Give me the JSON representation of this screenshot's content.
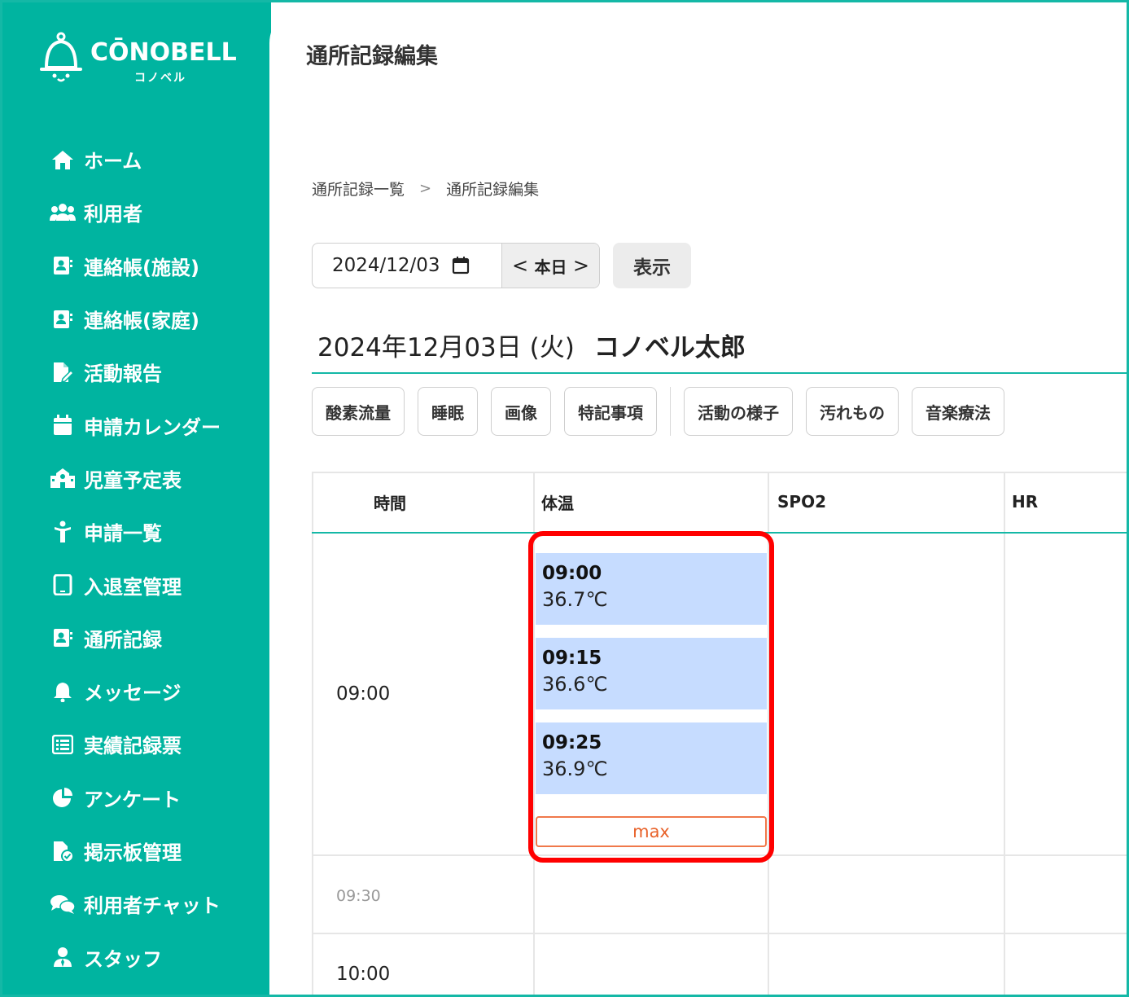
{
  "brand": {
    "name": "CŌNOBELL",
    "sub": "コノベル"
  },
  "sidebar": {
    "items": [
      {
        "label": "ホーム",
        "icon": "home-icon"
      },
      {
        "label": "利用者",
        "icon": "users-icon"
      },
      {
        "label": "連絡帳(施設)",
        "icon": "contact-book-icon"
      },
      {
        "label": "連絡帳(家庭)",
        "icon": "contact-book-icon"
      },
      {
        "label": "活動報告",
        "icon": "report-edit-icon"
      },
      {
        "label": "申請カレンダー",
        "icon": "calendar-icon"
      },
      {
        "label": "児童予定表",
        "icon": "school-icon"
      },
      {
        "label": "申請一覧",
        "icon": "child-icon"
      },
      {
        "label": "入退室管理",
        "icon": "tablet-icon"
      },
      {
        "label": "通所記録",
        "icon": "contact-book-icon"
      },
      {
        "label": "メッセージ",
        "icon": "bell-icon"
      },
      {
        "label": "実績記録票",
        "icon": "list-table-icon"
      },
      {
        "label": "アンケート",
        "icon": "pie-chart-icon"
      },
      {
        "label": "掲示板管理",
        "icon": "file-check-icon"
      },
      {
        "label": "利用者チャット",
        "icon": "chat-icon"
      },
      {
        "label": "スタッフ",
        "icon": "staff-icon"
      }
    ]
  },
  "header": {
    "title": "通所記録編集"
  },
  "breadcrumb": {
    "parent": "通所記録一覧",
    "separator": ">",
    "current": "通所記録編集"
  },
  "date_picker": {
    "value": "2024/12/03",
    "today_label": "本日",
    "prev": "<",
    "next": ">"
  },
  "show_button": "表示",
  "record": {
    "date": "2024年12月03日 (火)",
    "name": "コノベル太郎"
  },
  "tabs": [
    "酸素流量",
    "睡眠",
    "画像",
    "特記事項",
    "活動の様子",
    "汚れもの",
    "音楽療法"
  ],
  "grid": {
    "headers": {
      "time": "時間",
      "temp": "体温",
      "spo2": "SPO2",
      "hr": "HR"
    },
    "rows": [
      {
        "label": "09:00"
      },
      {
        "label": "09:30"
      },
      {
        "label": "10:00"
      }
    ],
    "entries": [
      {
        "time": "09:00",
        "value": "36.7℃"
      },
      {
        "time": "09:15",
        "value": "36.6℃"
      },
      {
        "time": "09:25",
        "value": "36.9℃"
      }
    ],
    "max_label": "max"
  },
  "colors": {
    "brand_teal": "#00b4a0",
    "entry_blue": "#c6dcff",
    "highlight_red": "#ff0000",
    "max_orange": "#e8622a"
  }
}
